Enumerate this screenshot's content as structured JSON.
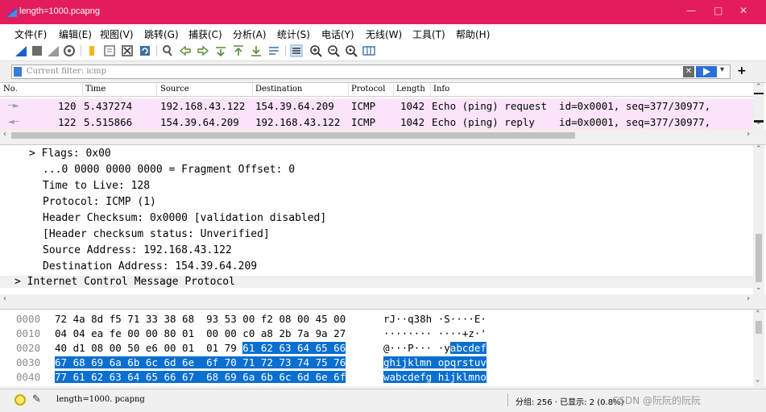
{
  "window": {
    "title": "length=1000.pcapng",
    "min": "—",
    "max": "□",
    "close": "✕"
  },
  "menu": [
    "文件(F)",
    "编辑(E)",
    "视图(V)",
    "跳转(G)",
    "捕获(C)",
    "分析(A)",
    "统计(S)",
    "电话(Y)",
    "无线(W)",
    "工具(T)",
    "帮助(H)"
  ],
  "filter": {
    "placeholder": "Current filter: icmp",
    "dropdown": "▾",
    "add": "+"
  },
  "packet_list": {
    "columns": [
      "No.",
      "Time",
      "Source",
      "Destination",
      "Protocol",
      "Length",
      "Info"
    ],
    "rows": [
      {
        "no": "120",
        "time": "5.437274",
        "source": "192.168.43.122",
        "destination": "154.39.64.209",
        "protocol": "ICMP",
        "length": "1042",
        "info": "Echo (ping) request  id=0x0001, seq=377/30977,"
      },
      {
        "no": "122",
        "time": "5.515866",
        "source": "154.39.64.209",
        "destination": "192.168.43.122",
        "protocol": "ICMP",
        "length": "1042",
        "info": "Echo (ping) reply    id=0x0001, seq=377/30977,"
      }
    ]
  },
  "details": {
    "lines": [
      "> Flags: 0x00",
      "...0 0000 0000 0000 = Fragment Offset: 0",
      "Time to Live: 128",
      "Protocol: ICMP (1)",
      "Header Checksum: 0x0000 [validation disabled]",
      "[Header checksum status: Unverified]",
      "Source Address: 192.168.43.122",
      "Destination Address: 154.39.64.209",
      "> Internet Control Message Protocol"
    ]
  },
  "bytes": {
    "rows": [
      {
        "offset": "0000",
        "hex_plain": "72 4a 8d f5 71 33 38 68  93 53 00 f2 08 00 45 00",
        "hex_sel": "",
        "ascii_plain": "rJ··q38h ·S····E·",
        "ascii_sel": ""
      },
      {
        "offset": "0010",
        "hex_plain": "04 04 ea fe 00 00 80 01  00 00 c0 a8 2b 7a 9a 27",
        "hex_sel": "",
        "ascii_plain": "········ ····+z·'",
        "ascii_sel": ""
      },
      {
        "offset": "0020",
        "hex_plain": "40 d1 08 00 50 e6 00 01  01 79 ",
        "hex_sel": "61 62 63 64 65 66",
        "ascii_plain": "@···P··· ·y",
        "ascii_sel": "abcdef"
      },
      {
        "offset": "0030",
        "hex_plain": "",
        "hex_sel": "67 68 69 6a 6b 6c 6d 6e  6f 70 71 72 73 74 75 76",
        "ascii_plain": "",
        "ascii_sel": "ghijklmn opqrstuv"
      },
      {
        "offset": "0040",
        "hex_plain": "",
        "hex_sel": "77 61 62 63 64 65 66 67  68 69 6a 6b 6c 6d 6e 6f",
        "ascii_plain": "",
        "ascii_sel": "wabcdefg hijklmno"
      }
    ]
  },
  "status": {
    "file": "length=1000. pcapng",
    "stats": "分组: 256 · 已显示: 2 (0.8%)",
    "watermark": "CSDN @阮阮的阮阮"
  },
  "colors": {
    "titlebar": "#e31d5c",
    "row_bg": "#fbe4f9",
    "selection": "#0a6fd0"
  }
}
